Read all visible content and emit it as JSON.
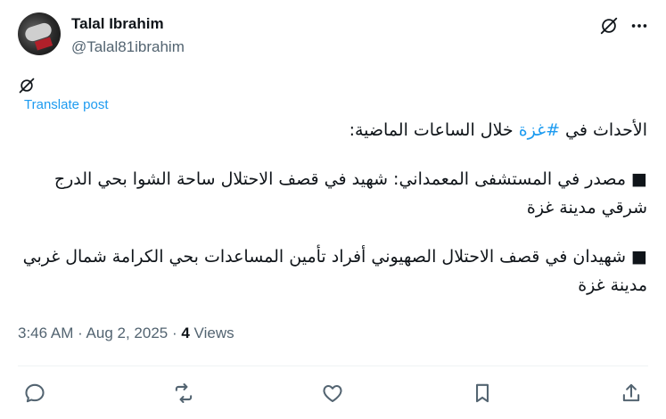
{
  "author": {
    "display_name": "Talal Ibrahim",
    "handle": "@Talal81ibrahim"
  },
  "translate_label": "Translate post",
  "post": {
    "line1_before": "الأحداث في ",
    "hashtag": "#غزة",
    "line1_after": " خلال الساعات الماضية:",
    "item1": "■ مصدر في المستشفى المعمداني: شهيد في قصف الاحتلال ساحة الشوا بحي الدرج شرقي مدينة غزة",
    "item2": "■ شهيدان في قصف الاحتلال الصهيوني أفراد تأمين المساعدات بحي الكرامة شمال غربي مدينة غزة"
  },
  "meta": {
    "time": "3:46 AM",
    "separator1": " · ",
    "date": "Aug 2, 2025",
    "separator2": " · ",
    "views_count": "4",
    "views_label": " Views"
  },
  "colors": {
    "link": "#1d9bf0",
    "muted": "#536471",
    "text": "#0f1419"
  },
  "icons": {
    "header_grok": "grok-icon",
    "header_more": "more-dots-icon",
    "translate_grok": "grok-icon",
    "reply": "reply-icon",
    "repost": "repost-icon",
    "like": "heart-icon",
    "bookmark": "bookmark-icon",
    "share": "share-icon"
  }
}
